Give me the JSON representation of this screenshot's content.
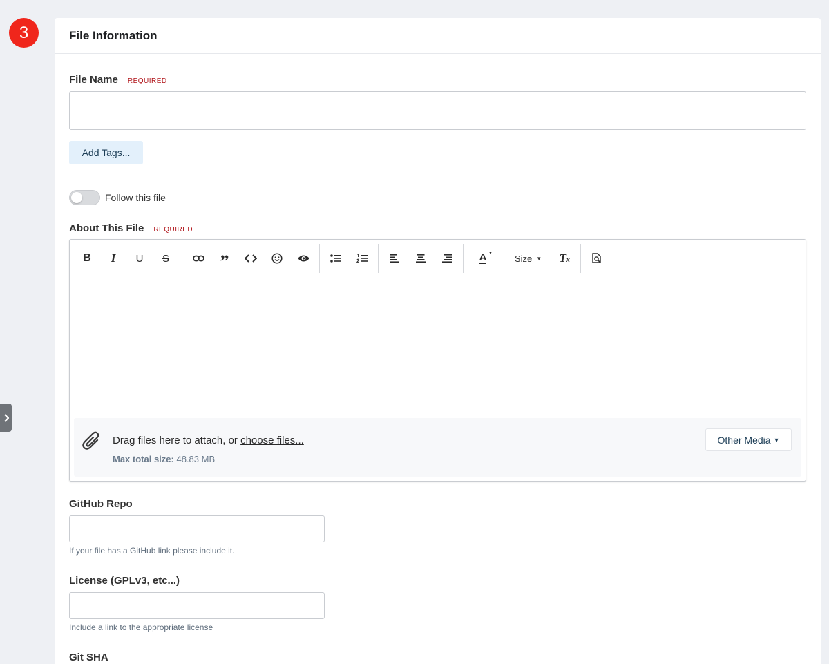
{
  "step": {
    "number": "3"
  },
  "card": {
    "title": "File Information"
  },
  "file_name": {
    "label": "File Name",
    "required": "REQUIRED",
    "value": ""
  },
  "tags": {
    "button_label": "Add Tags..."
  },
  "follow": {
    "label": "Follow this file",
    "enabled": false
  },
  "about": {
    "label": "About This File",
    "required": "REQUIRED",
    "toolbar": {
      "bold": "B",
      "italic": "I",
      "underline": "U",
      "strike": "S",
      "quote": "”",
      "text_color": "A",
      "size": "Size",
      "clear_format_t": "T",
      "clear_format_x": "x"
    },
    "attach": {
      "prefix": "Drag files here to attach, or ",
      "link": "choose files...",
      "max_label": "Max total size:",
      "max_value": "48.83 MB",
      "other_media": "Other Media"
    }
  },
  "github": {
    "label": "GitHub Repo",
    "value": "",
    "help": "If your file has a GitHub link please include it."
  },
  "license": {
    "label": "License (GPLv3, etc...)",
    "value": "",
    "help": "Include a link to the appropriate license"
  },
  "git_sha": {
    "label": "Git SHA"
  },
  "colors": {
    "badge": "#f0261c",
    "required": "#b0141a",
    "tags_bg": "#e3f0fb",
    "link": "#1c3d56"
  }
}
